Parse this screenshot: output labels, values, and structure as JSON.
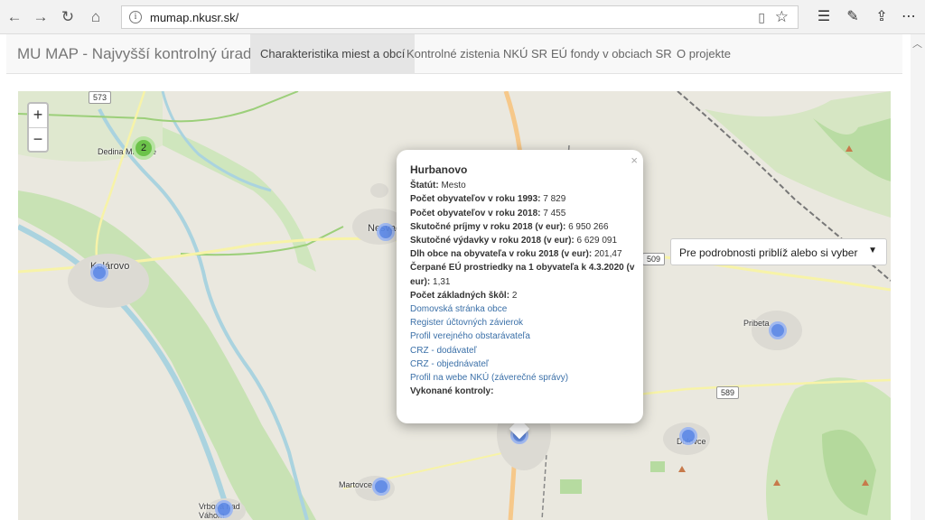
{
  "browser": {
    "url": "mumap.nkusr.sk/"
  },
  "site": {
    "brand": "MU MAP - Najvyšší kontrolný úrad SR",
    "nav": [
      {
        "label": "Charakteristika miest a obcí",
        "active": true
      },
      {
        "label": "Kontrolné zistenia NKÚ SR",
        "active": false
      },
      {
        "label": "EÚ fondy v obciach SR",
        "active": false
      },
      {
        "label": "O projekte",
        "active": false
      }
    ]
  },
  "map": {
    "zoom_in": "+",
    "zoom_out": "−",
    "select_placeholder": "Pre podrobnosti priblíž alebo si vyber",
    "cluster_count": "2",
    "places": [
      "Dedina Mládeže",
      "Kolárovo",
      "Nesvady",
      "Martovce",
      "Vrbová nad Váhom",
      "Pribeta",
      "Dulovce"
    ],
    "road_numbers": [
      "573",
      "509",
      "589"
    ]
  },
  "popup": {
    "close": "×",
    "title": "Hurbanovo",
    "status_label": "Štatút:",
    "status_value": "Mesto",
    "pop1993_label": "Počet obyvateľov v roku 1993:",
    "pop1993_value": "7 829",
    "pop2018_label": "Počet obyvateľov v roku 2018:",
    "pop2018_value": "7 455",
    "income_label": "Skutočné príjmy v roku 2018 (v eur):",
    "income_value": "6 950 266",
    "expense_label": "Skutočné výdavky v roku 2018 (v eur):",
    "expense_value": "6 629 091",
    "debt_label": "Dlh obce na obyvateľa v roku 2018 (v eur):",
    "debt_value": "201,47",
    "eu_label": "Čerpané EÚ prostriedky na 1 obyvateľa k 4.3.2020 (v eur):",
    "eu_value": "1,31",
    "schools_label": "Počet základných škôl:",
    "schools_value": "2",
    "links": [
      "Domovská stránka obce",
      "Register účtovných závierok",
      "Profil verejného obstarávateľa",
      "CRZ - dodávateľ",
      "CRZ - objednávateľ",
      "Profil na webe NKÚ (záverečné správy)"
    ],
    "inspections_label": "Vykonané kontroly:"
  },
  "icons": {
    "back": "back-arrow-icon",
    "forward": "forward-arrow-icon",
    "refresh": "refresh-icon",
    "home": "home-icon"
  }
}
